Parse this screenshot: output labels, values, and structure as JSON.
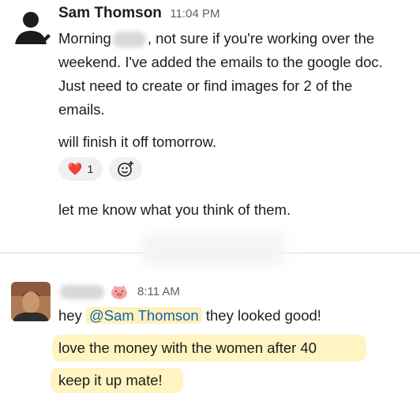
{
  "message1": {
    "author": "Sam Thomson",
    "time": "11:04 PM",
    "line1_pre": "Morning",
    "line1_post": ", not sure if you're working over the",
    "line2": "weekend. I've added the emails to the google doc.",
    "line3": "Just need to create or find images for 2 of the",
    "line4": "emails.",
    "line5": "will finish it off tomorrow.",
    "reaction": {
      "emoji": "❤️",
      "count": "1"
    },
    "add_reaction_icon": "emoji-plus-icon",
    "line6": "let me know what you think of them."
  },
  "message2": {
    "time": "8:11 AM",
    "line1_pre": "hey",
    "mention": "@Sam Thomson",
    "line1_post": "they looked good!",
    "line2": "love the money with the women after 40",
    "line3": "keep it up mate!"
  },
  "colors": {
    "highlight": "#fff4c2",
    "mention": "#1264a3",
    "reaction_bg": "#f0f0f0"
  }
}
